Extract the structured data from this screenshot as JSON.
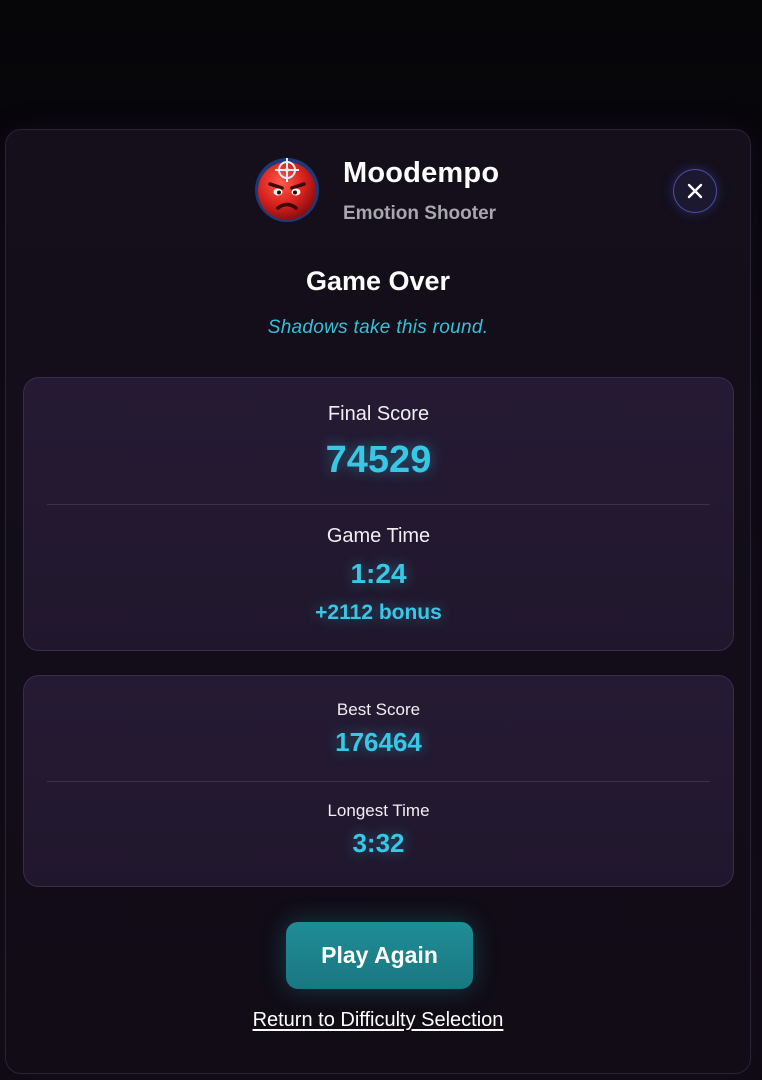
{
  "app": {
    "title": "Moodempo",
    "subtitle": "Emotion Shooter",
    "logo_icon": "angry-face-crosshair-icon"
  },
  "close_icon": "close-icon",
  "result": {
    "heading": "Game Over",
    "tagline": "Shadows take this round."
  },
  "current_run": {
    "final_score_label": "Final Score",
    "final_score_value": "74529",
    "game_time_label": "Game Time",
    "game_time_value": "1:24",
    "bonus": "+2112 bonus"
  },
  "records": {
    "best_score_label": "Best Score",
    "best_score_value": "176464",
    "longest_time_label": "Longest Time",
    "longest_time_value": "3:32"
  },
  "actions": {
    "play_again_label": "Play Again",
    "return_label": "Return to Difficulty Selection"
  },
  "colors": {
    "accent": "#38c8e6",
    "button": "#1f8d96",
    "panel": "#231830",
    "background": "#0b080f"
  }
}
